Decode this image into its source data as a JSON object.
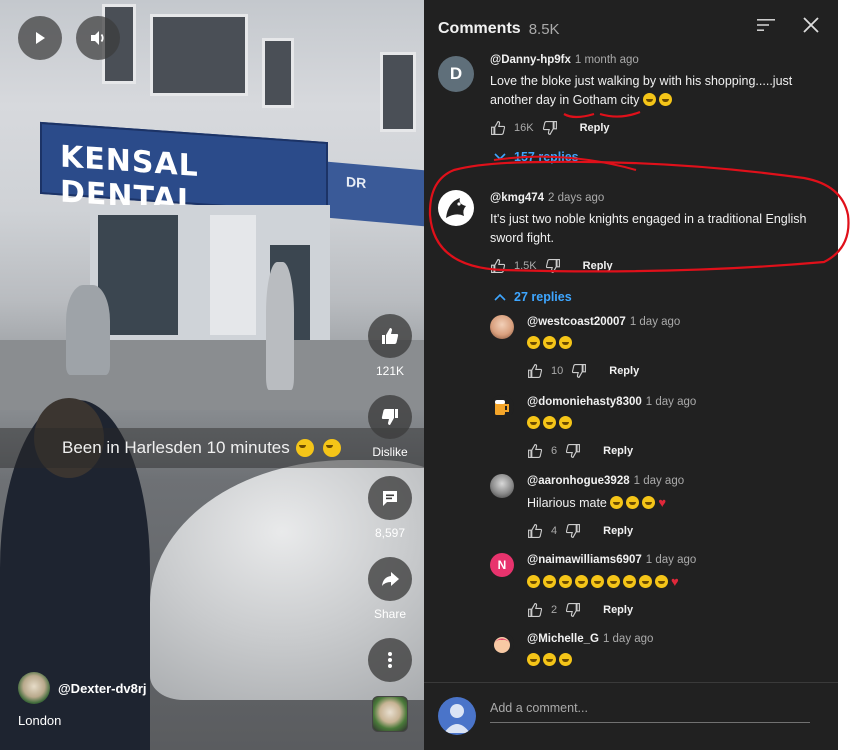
{
  "video": {
    "shop_sign": "KENSAL DENTAL",
    "caption_text": "Been in Harlesden 10 minutes",
    "likes_count": "121K",
    "dislike_label": "Dislike",
    "comments_count": "8,597",
    "share_label": "Share",
    "channel_handle": "@Dexter-dv8rj",
    "location": "London"
  },
  "comments_panel": {
    "title": "Comments",
    "count": "8.5K",
    "add_placeholder": "Add a comment...",
    "threads": [
      {
        "avatar_letter": "D",
        "avatar_color": "#5f6f7a",
        "handle": "@Danny-hp9fx",
        "time": "1 month ago",
        "text": "Love the bloke just walking by with his shopping.....just another day in Gotham city",
        "likes": "16K",
        "reply_label": "Reply",
        "replies_label": "157 replies"
      },
      {
        "handle": "@kmg474",
        "time": "2 days ago",
        "text": "It's just two noble knights engaged in a traditional English sword fight.",
        "likes": "1.5K",
        "reply_label": "Reply",
        "replies_label": "27 replies",
        "replies": [
          {
            "handle": "@westcoast20007",
            "time": "1 day ago",
            "text": "",
            "likes": "10",
            "reply_label": "Reply"
          },
          {
            "handle": "@domoniehasty8300",
            "time": "1 day ago",
            "text": "",
            "likes": "6",
            "reply_label": "Reply"
          },
          {
            "handle": "@aaronhogue3928",
            "time": "1 day ago",
            "text": "Hilarious mate",
            "likes": "4",
            "reply_label": "Reply"
          },
          {
            "avatar_letter": "N",
            "avatar_color": "#e8336d",
            "handle": "@naimawilliams6907",
            "time": "1 day ago",
            "text": "",
            "likes": "2",
            "reply_label": "Reply"
          },
          {
            "handle": "@Michelle_G",
            "time": "1 day ago",
            "text": ""
          }
        ]
      }
    ]
  },
  "colors": {
    "panel_bg": "#212121",
    "link_blue": "#3ea6ff",
    "annotation_red": "#e0101a"
  }
}
